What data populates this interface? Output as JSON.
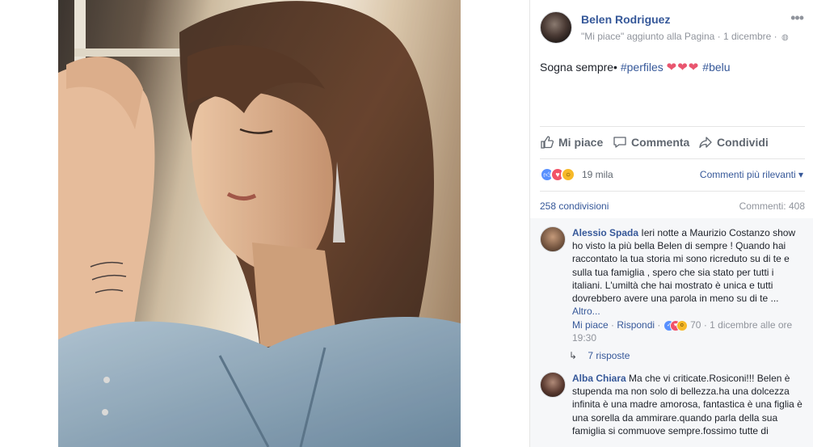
{
  "post": {
    "author": "Belen Rodriguez",
    "meta": "\"Mi piace\" aggiunto alla Pagina · 1 dicembre ·",
    "globe_icon": "globe-icon",
    "caption_text": "Sogna sempre•",
    "caption_tag1": "#perfiles",
    "caption_hearts": "❤❤❤",
    "caption_tag2": "#belu"
  },
  "actions": {
    "like": "Mi piace",
    "comment": "Commenta",
    "share": "Condividi"
  },
  "reactions": {
    "count": "19 mila",
    "sort": "Commenti più rilevanti ▾"
  },
  "stats": {
    "shares": "258 condivisioni",
    "comments": "Commenti: 408"
  },
  "comments": [
    {
      "name": "Alessio Spada",
      "text": "Ieri notte a Maurizio Costanzo show ho visto la più bella Belen di sempre ! Quando hai raccontato la tua storia mi sono ricreduto su di te e sulla tua famiglia , spero che sia stato per tutti i italiani. L'umiltà che hai mostrato è unica e tutti dovrebbero avere una parola in meno su di te ...",
      "more": "Altro...",
      "like": "Mi piace",
      "reply": "Rispondi",
      "reaction_count": "70",
      "time": "1 dicembre alle ore 19:30",
      "replies": "7 risposte"
    },
    {
      "name": "Alba Chiara",
      "text": "Ma che vi criticate.Rosiconi!!! Belen è stupenda ma non solo di bellezza.ha una dolcezza infinita è una madre amorosa, fantastica è una figlia è una sorella da ammirare.quando parla della sua famiglia si commuove sempre.fossimo tutte di"
    }
  ],
  "colors": {
    "link": "#365899",
    "secondary_text": "#90949c",
    "like_blue": "#5890ff",
    "love_red": "#f25268",
    "wow_yellow": "#f7b928"
  }
}
